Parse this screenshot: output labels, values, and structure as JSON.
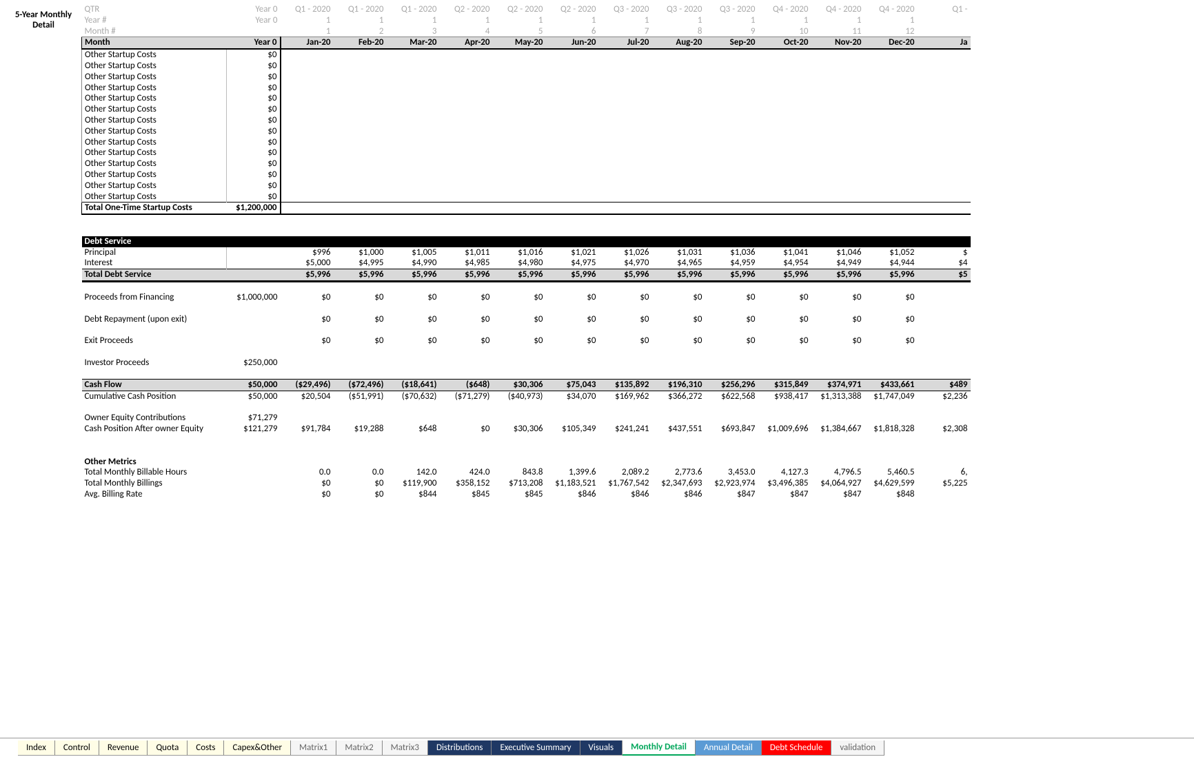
{
  "title": "5-Year Monthly Detail",
  "header_rows": {
    "qtr_label": "QTR",
    "year_num_label": "Year #",
    "month_num_label": "Month #",
    "month_label": "Month",
    "year0": "Year 0",
    "qtr": [
      "Q1 - 2020",
      "Q1 - 2020",
      "Q1 - 2020",
      "Q2 - 2020",
      "Q2 - 2020",
      "Q2 - 2020",
      "Q3 - 2020",
      "Q3 - 2020",
      "Q3 - 2020",
      "Q4 - 2020",
      "Q4 - 2020",
      "Q4 - 2020",
      "Q1 -"
    ],
    "year_num": [
      "1",
      "1",
      "1",
      "1",
      "1",
      "1",
      "1",
      "1",
      "1",
      "1",
      "1",
      "1",
      ""
    ],
    "month_num": [
      "1",
      "2",
      "3",
      "4",
      "5",
      "6",
      "7",
      "8",
      "9",
      "10",
      "11",
      "12",
      ""
    ],
    "months": [
      "Jan-20",
      "Feb-20",
      "Mar-20",
      "Apr-20",
      "May-20",
      "Jun-20",
      "Jul-20",
      "Aug-20",
      "Sep-20",
      "Oct-20",
      "Nov-20",
      "Dec-20",
      "Ja"
    ]
  },
  "startup": {
    "label": "Other Startup Costs",
    "y0": "$0",
    "count": 14,
    "total_label": "Total One-Time Startup Costs",
    "total": "$1,200,000"
  },
  "debt": {
    "section": "Debt Service",
    "principal_label": "Principal",
    "interest_label": "Interest",
    "total_label": "Total Debt Service",
    "principal": [
      "$996",
      "$1,000",
      "$1,005",
      "$1,011",
      "$1,016",
      "$1,021",
      "$1,026",
      "$1,031",
      "$1,036",
      "$1,041",
      "$1,046",
      "$1,052",
      "$"
    ],
    "interest": [
      "$5,000",
      "$4,995",
      "$4,990",
      "$4,985",
      "$4,980",
      "$4,975",
      "$4,970",
      "$4,965",
      "$4,959",
      "$4,954",
      "$4,949",
      "$4,944",
      "$4"
    ],
    "total": [
      "$5,996",
      "$5,996",
      "$5,996",
      "$5,996",
      "$5,996",
      "$5,996",
      "$5,996",
      "$5,996",
      "$5,996",
      "$5,996",
      "$5,996",
      "$5,996",
      "$5"
    ]
  },
  "proceeds_financing": {
    "label": "Proceeds from Financing",
    "y0": "$1,000,000",
    "vals": [
      "$0",
      "$0",
      "$0",
      "$0",
      "$0",
      "$0",
      "$0",
      "$0",
      "$0",
      "$0",
      "$0",
      "$0",
      ""
    ]
  },
  "debt_repayment": {
    "label": "Debt Repayment (upon exit)",
    "y0": "",
    "vals": [
      "$0",
      "$0",
      "$0",
      "$0",
      "$0",
      "$0",
      "$0",
      "$0",
      "$0",
      "$0",
      "$0",
      "$0",
      ""
    ]
  },
  "exit_proceeds": {
    "label": "Exit Proceeds",
    "y0": "",
    "vals": [
      "$0",
      "$0",
      "$0",
      "$0",
      "$0",
      "$0",
      "$0",
      "$0",
      "$0",
      "$0",
      "$0",
      "$0",
      ""
    ]
  },
  "investor_proceeds": {
    "label": "Investor Proceeds",
    "y0": "$250,000",
    "vals": []
  },
  "cash_flow": {
    "label": "Cash Flow",
    "y0": "$50,000",
    "vals": [
      "($29,496)",
      "($72,496)",
      "($18,641)",
      "($648)",
      "$30,306",
      "$75,043",
      "$135,892",
      "$196,310",
      "$256,296",
      "$315,849",
      "$374,971",
      "$433,661",
      "$489"
    ]
  },
  "cum_cash": {
    "label": "Cumulative Cash Position",
    "y0": "$50,000",
    "vals": [
      "$20,504",
      "($51,991)",
      "($70,632)",
      "($71,279)",
      "($40,973)",
      "$34,070",
      "$169,962",
      "$366,272",
      "$622,568",
      "$938,417",
      "$1,313,388",
      "$1,747,049",
      "$2,236"
    ]
  },
  "owner_equity": {
    "label": "Owner Equity Contributions",
    "y0": "$71,279",
    "vals": []
  },
  "cash_after": {
    "label": "Cash Position After owner Equity",
    "y0": "$121,279",
    "vals": [
      "$91,784",
      "$19,288",
      "$648",
      "$0",
      "$30,306",
      "$105,349",
      "$241,241",
      "$437,551",
      "$693,847",
      "$1,009,696",
      "$1,384,667",
      "$1,818,328",
      "$2,308"
    ]
  },
  "other_metrics": {
    "label": "Other Metrics",
    "hours_label": "Total Monthly Billable Hours",
    "billings_label": "Total Monthly Billings",
    "rate_label": "Avg. Billing Rate",
    "hours": [
      "0.0",
      "0.0",
      "142.0",
      "424.0",
      "843.8",
      "1,399.6",
      "2,089.2",
      "2,773.6",
      "3,453.0",
      "4,127.3",
      "4,796.5",
      "5,460.5",
      "6,"
    ],
    "billings": [
      "$0",
      "$0",
      "$119,900",
      "$358,152",
      "$713,208",
      "$1,183,521",
      "$1,767,542",
      "$2,347,693",
      "$2,923,974",
      "$3,496,385",
      "$4,064,927",
      "$4,629,599",
      "$5,225"
    ],
    "rate": [
      "$0",
      "$0",
      "$844",
      "$845",
      "$845",
      "$846",
      "$846",
      "$846",
      "$847",
      "$847",
      "$847",
      "$848",
      ""
    ]
  },
  "tabs": [
    {
      "label": "Index",
      "cls": "yellow"
    },
    {
      "label": "Control",
      "cls": "yellow"
    },
    {
      "label": "Revenue",
      "cls": "yellow"
    },
    {
      "label": "Quota",
      "cls": "yellow"
    },
    {
      "label": "Costs",
      "cls": "yellow"
    },
    {
      "label": "Capex&Other",
      "cls": "yellow"
    },
    {
      "label": "Matrix1",
      "cls": "gr"
    },
    {
      "label": "Matrix2",
      "cls": "gr"
    },
    {
      "label": "Matrix3",
      "cls": "gr"
    },
    {
      "label": "Distributions",
      "cls": "navy"
    },
    {
      "label": "Executive Summary",
      "cls": "navy"
    },
    {
      "label": "Visuals",
      "cls": "navy"
    },
    {
      "label": "Monthly Detail",
      "cls": "active"
    },
    {
      "label": "Annual Detail",
      "cls": "blue"
    },
    {
      "label": "Debt Schedule",
      "cls": "red"
    },
    {
      "label": "validation",
      "cls": "gr"
    }
  ]
}
